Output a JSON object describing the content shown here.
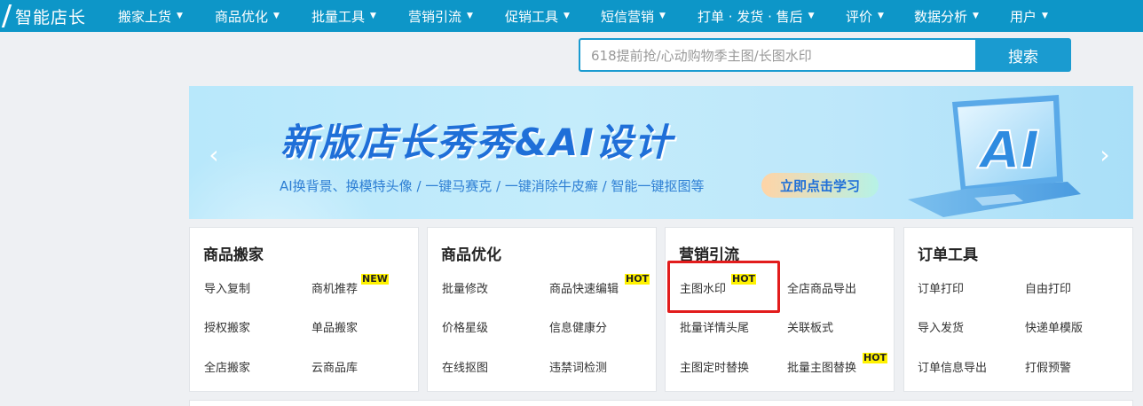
{
  "app": {
    "logo": "智能店长"
  },
  "nav": {
    "items": [
      {
        "label": "搬家上货"
      },
      {
        "label": "商品优化"
      },
      {
        "label": "批量工具"
      },
      {
        "label": "营销引流"
      },
      {
        "label": "促销工具"
      },
      {
        "label": "短信营销"
      },
      {
        "label": "打单 · 发货 · 售后"
      },
      {
        "label": "评价"
      },
      {
        "label": "数据分析"
      },
      {
        "label": "用户"
      }
    ],
    "caret": "▼"
  },
  "search": {
    "placeholder": "618提前抢/心动购物季主图/长图水印",
    "button": "搜索"
  },
  "banner": {
    "title": "新版店长秀秀&AI设计",
    "subtitle": "AI换背景、换模特头像 / 一键马赛克 / 一键消除牛皮癣 / 智能一键抠图等",
    "cta": "立即点击学习",
    "laptop_text": "AI",
    "prev": "‹",
    "next": "›",
    "colors": {
      "title": "#1f6fd8",
      "background": "#c4ecfb"
    }
  },
  "cards": [
    {
      "title": "商品搬家",
      "links": [
        {
          "label": "导入复制",
          "tag": ""
        },
        {
          "label": "商机推荐",
          "tag": "NEW"
        },
        {
          "label": "授权搬家",
          "tag": ""
        },
        {
          "label": "单品搬家",
          "tag": ""
        },
        {
          "label": "全店搬家",
          "tag": ""
        },
        {
          "label": "云商品库",
          "tag": ""
        }
      ]
    },
    {
      "title": "商品优化",
      "links": [
        {
          "label": "批量修改",
          "tag": ""
        },
        {
          "label": "商品快速编辑",
          "tag": "HOT"
        },
        {
          "label": "价格星级",
          "tag": ""
        },
        {
          "label": "信息健康分",
          "tag": ""
        },
        {
          "label": "在线抠图",
          "tag": ""
        },
        {
          "label": "违禁词检测",
          "tag": ""
        }
      ]
    },
    {
      "title": "营销引流",
      "links": [
        {
          "label": "主图水印",
          "tag": "HOT"
        },
        {
          "label": "全店商品导出",
          "tag": ""
        },
        {
          "label": "批量详情头尾",
          "tag": ""
        },
        {
          "label": "关联板式",
          "tag": ""
        },
        {
          "label": "主图定时替换",
          "tag": ""
        },
        {
          "label": "批量主图替换",
          "tag": "HOT"
        }
      ]
    },
    {
      "title": "订单工具",
      "links": [
        {
          "label": "订单打印",
          "tag": ""
        },
        {
          "label": "自由打印",
          "tag": ""
        },
        {
          "label": "导入发货",
          "tag": ""
        },
        {
          "label": "快递单模版",
          "tag": ""
        },
        {
          "label": "订单信息导出",
          "tag": ""
        },
        {
          "label": "打假预警",
          "tag": ""
        }
      ]
    }
  ],
  "theme": {
    "nav_bg": "#0d96c8",
    "accent": "#1a9bd0",
    "highlight": "#e21c1c",
    "tag_bg": "#fff200"
  }
}
